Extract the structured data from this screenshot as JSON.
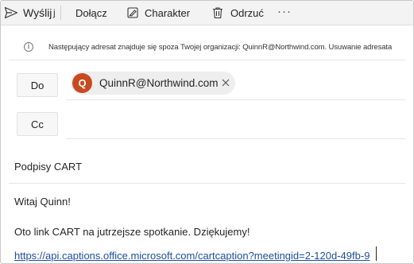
{
  "toolbar": {
    "send_label": "Wyślij",
    "attach_label": "Dołącz",
    "style_label": "Charakter",
    "discard_label": "Odrzuć",
    "more_label": "···"
  },
  "banner": {
    "text": "Następujący adresat znajduje się spoza Twojej organizacji: QuinnR@Northwind.com. Usuwanie adresata"
  },
  "recipients": {
    "to_label": "Do",
    "cc_label": "Cc",
    "to_chip": {
      "initial": "Q",
      "email": "QuinnR@Northwind.com",
      "avatar_color": "#c74a1f"
    }
  },
  "subject": "Podpisy CART",
  "body": {
    "greeting": "Witaj Quinn!",
    "message": "Oto link CART na jutrzejsze spotkanie. Dziękujemy!",
    "link": "https://api.captions.office.microsoft.com/cartcaption?meetingid=2-120d-49fb-9"
  },
  "colors": {
    "accent_link": "#1f4e9c",
    "toolbar_bg": "#f3f3f3"
  }
}
